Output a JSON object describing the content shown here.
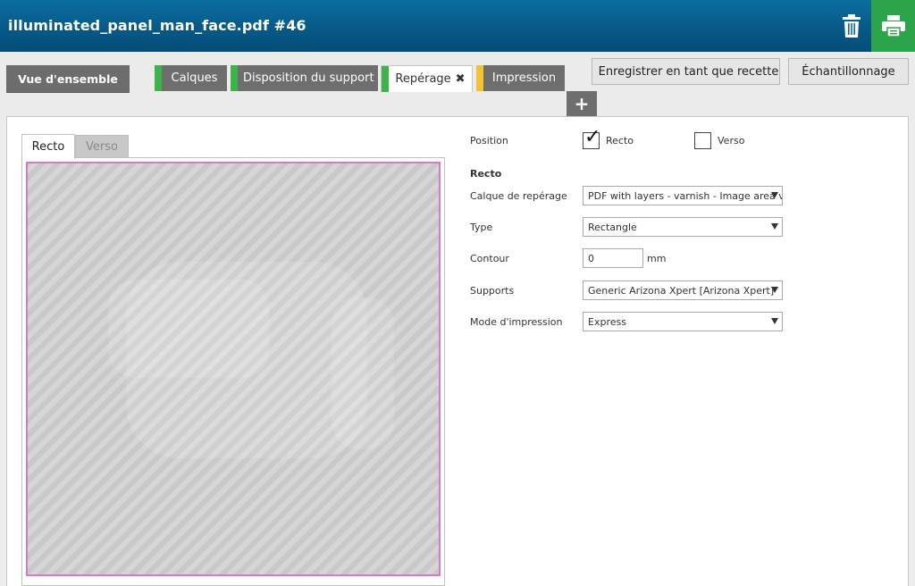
{
  "header": {
    "title": "illuminated_panel_man_face.pdf #46",
    "trash_icon": "trash-icon",
    "print_icon": "printer-icon",
    "print_color": "#2ba44a"
  },
  "tabs": [
    {
      "label": "Vue d'ensemble",
      "marker": null
    },
    {
      "label": "Calques",
      "marker": "#3db34a"
    },
    {
      "label": "Disposition du support",
      "marker": "#3db34a"
    },
    {
      "label": "Repérage",
      "marker": "#3db34a",
      "active": true,
      "close_icon": "close-icon"
    },
    {
      "label": "Impression",
      "marker": "#f2c530"
    }
  ],
  "add_tab_label": "+",
  "actions": {
    "save_recipe": "Enregistrer en tant que recette",
    "sample": "Échantillonnage"
  },
  "preview": {
    "tabs": [
      "Recto",
      "Verso"
    ],
    "active_tab": "Recto",
    "border_color": "#d879c8"
  },
  "form": {
    "position_label": "Position",
    "position_options": [
      {
        "label": "Recto",
        "checked": true
      },
      {
        "label": "Verso",
        "checked": false
      }
    ],
    "section_title": "Recto",
    "fields": {
      "layer": {
        "label": "Calque de repérage",
        "value": "PDF with layers - varnish - Image area varnish"
      },
      "type": {
        "label": "Type",
        "value": "Rectangle"
      },
      "contour": {
        "label": "Contour",
        "value": "0",
        "unit": "mm"
      },
      "media": {
        "label": "Supports",
        "value": "Generic Arizona Xpert [Arizona Xpert]"
      },
      "print_mode": {
        "label": "Mode d'impression",
        "value": "Express"
      }
    }
  }
}
